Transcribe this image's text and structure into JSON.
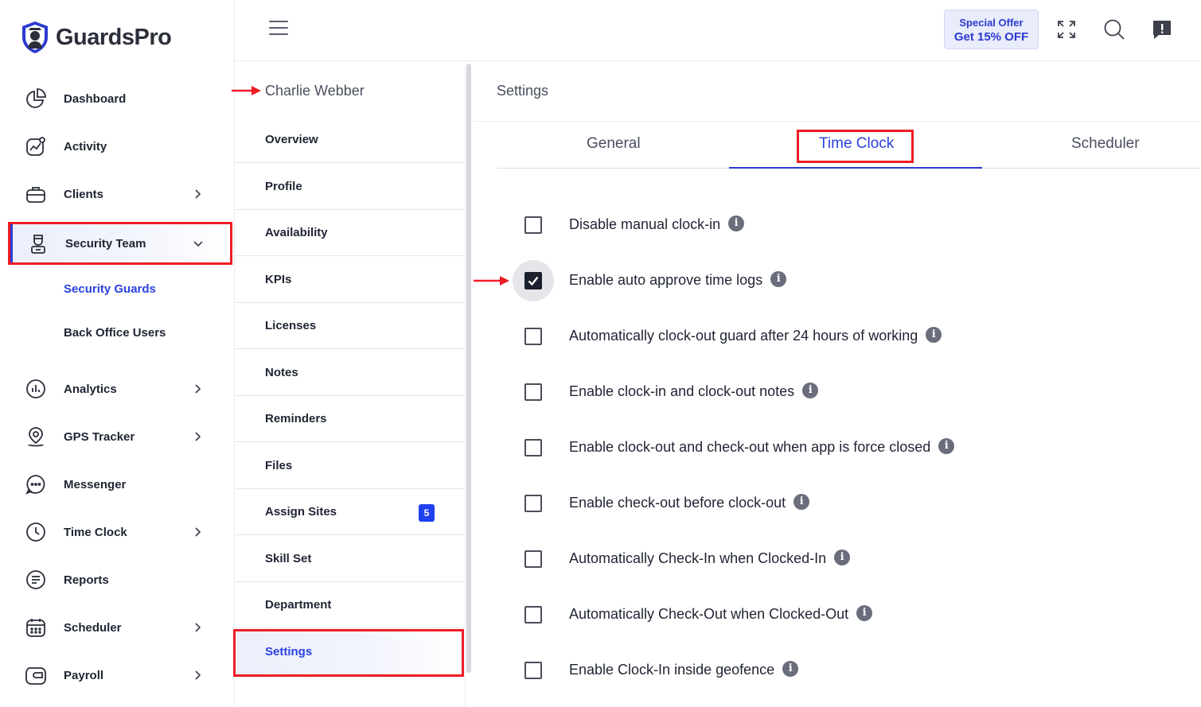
{
  "brand": {
    "name": "GuardsPro"
  },
  "sidebar": {
    "items": [
      {
        "label": "Dashboard",
        "icon": "dashboard-icon",
        "chevron": false
      },
      {
        "label": "Activity",
        "icon": "activity-icon",
        "chevron": false
      },
      {
        "label": "Clients",
        "icon": "clients-icon",
        "chevron": true
      },
      {
        "label": "Security Team",
        "icon": "security-team-icon",
        "chevron": true,
        "active": true
      },
      {
        "label": "Analytics",
        "icon": "analytics-icon",
        "chevron": true
      },
      {
        "label": "GPS Tracker",
        "icon": "gps-tracker-icon",
        "chevron": true
      },
      {
        "label": "Messenger",
        "icon": "messenger-icon",
        "chevron": false
      },
      {
        "label": "Time Clock",
        "icon": "time-clock-icon",
        "chevron": true
      },
      {
        "label": "Reports",
        "icon": "reports-icon",
        "chevron": false
      },
      {
        "label": "Scheduler",
        "icon": "scheduler-icon",
        "chevron": true
      },
      {
        "label": "Payroll",
        "icon": "payroll-icon",
        "chevron": true
      }
    ],
    "sub_items": [
      {
        "label": "Security Guards",
        "current": true
      },
      {
        "label": "Back Office Users",
        "current": false
      }
    ]
  },
  "topbar": {
    "offer_line1": "Special Offer",
    "offer_line2": "Get 15% OFF",
    "icons": [
      "fullscreen-icon",
      "search-icon",
      "feedback-icon"
    ]
  },
  "person": {
    "name": "Charlie Webber"
  },
  "profile_menu": [
    {
      "label": "Overview"
    },
    {
      "label": "Profile"
    },
    {
      "label": "Availability"
    },
    {
      "label": "KPIs"
    },
    {
      "label": "Licenses"
    },
    {
      "label": "Notes"
    },
    {
      "label": "Reminders"
    },
    {
      "label": "Files"
    },
    {
      "label": "Assign Sites",
      "badge": "5"
    },
    {
      "label": "Skill Set"
    },
    {
      "label": "Department"
    },
    {
      "label": "Settings",
      "selected": true
    }
  ],
  "settings": {
    "title": "Settings",
    "tabs": [
      {
        "label": "General"
      },
      {
        "label": "Time Clock",
        "active": true
      },
      {
        "label": "Scheduler"
      }
    ],
    "options": [
      {
        "label": "Disable manual clock-in",
        "checked": false
      },
      {
        "label": "Enable auto approve time logs",
        "checked": true
      },
      {
        "label": "Automatically clock-out guard after 24 hours of working",
        "checked": false
      },
      {
        "label": "Enable clock-in and clock-out notes",
        "checked": false
      },
      {
        "label": "Enable clock-out and check-out when app is force closed",
        "checked": false
      },
      {
        "label": "Enable check-out before clock-out",
        "checked": false
      },
      {
        "label": "Automatically Check-In when Clocked-In",
        "checked": false
      },
      {
        "label": "Automatically Check-Out when Clocked-Out",
        "checked": false
      },
      {
        "label": "Enable Clock-In inside geofence",
        "checked": false
      }
    ]
  },
  "colors": {
    "accent": "#2a41e0",
    "highlight_red": "#ee1c25",
    "badge_blue": "#1f3ff0"
  }
}
